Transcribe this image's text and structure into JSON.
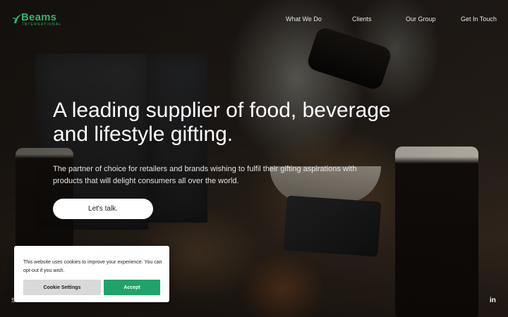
{
  "brand": {
    "name": "Beams",
    "subline": "INTERNATIONAL",
    "accent_color": "#2fb36e"
  },
  "nav": {
    "items": [
      {
        "label": "What We Do"
      },
      {
        "label": "Clients"
      },
      {
        "label": "Our Group"
      },
      {
        "label": "Get In Touch"
      }
    ]
  },
  "hero": {
    "headline": "A leading supplier of food, beverage and lifestyle gifting.",
    "subtext": "The partner of choice for retailers and brands wishing to fulfil their gifting aspirations with products that will delight consumers all over the world.",
    "cta_label": "Let's talk."
  },
  "cookie_banner": {
    "text": "This website uses cookies to improve your experience. You can opt-out if you wish.",
    "settings_label": "Cookie Settings",
    "accept_label": "Accept",
    "accept_color": "#1fa36a"
  },
  "footer": {
    "left_hint": "S",
    "social_icon": "linkedin-icon",
    "social_label": "in"
  }
}
